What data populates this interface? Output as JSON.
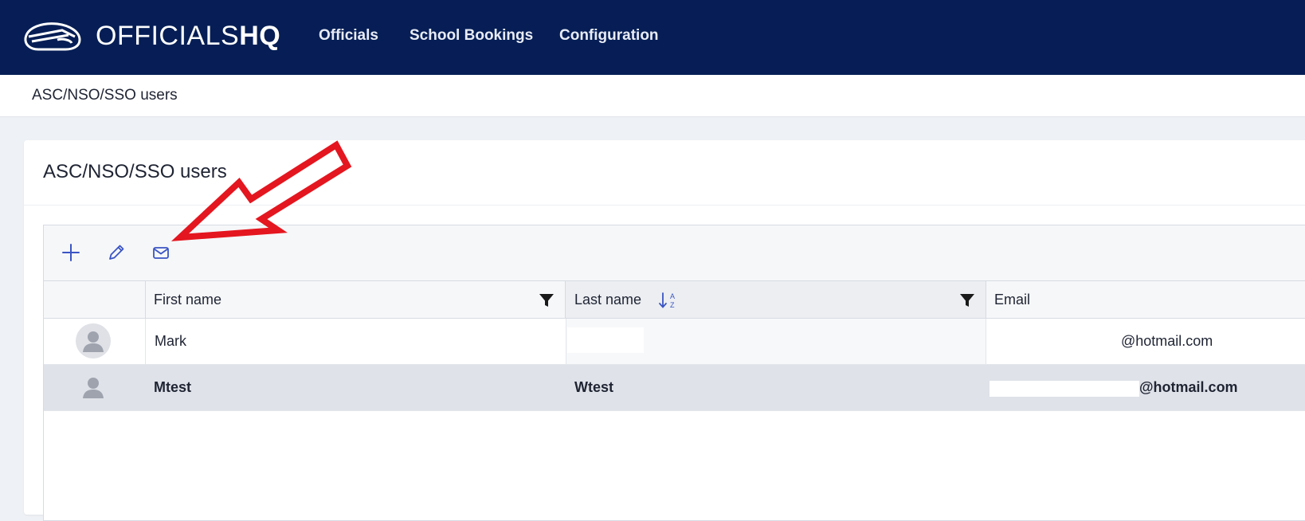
{
  "brand": {
    "light": "OFFICIALS",
    "bold": "HQ",
    "logo_icon": "helmet-logo-icon"
  },
  "nav": [
    {
      "label": "Officials"
    },
    {
      "label": "School Bookings"
    },
    {
      "label": "Configuration"
    }
  ],
  "breadcrumb": "ASC/NSO/SSO users",
  "card": {
    "title": "ASC/NSO/SSO users"
  },
  "toolbar": {
    "icons": [
      "plus-icon",
      "pencil-icon",
      "envelope-icon"
    ]
  },
  "columns": [
    {
      "label": "",
      "key": "avatar"
    },
    {
      "label": "First name",
      "filter": true
    },
    {
      "label": "Last name",
      "filter": true,
      "sort": "ascending"
    },
    {
      "label": "Email"
    }
  ],
  "rows": [
    {
      "first_name": "Mark",
      "last_name": "",
      "email": "@hotmail.com",
      "selected": false
    },
    {
      "first_name": "Mtest",
      "last_name": "Wtest",
      "email": "@hotmail.com",
      "selected": true
    }
  ],
  "colors": {
    "topbar": "#061e55",
    "accent_icon": "#3b55c4",
    "annotation_arrow": "#e4161f",
    "selected_row": "#dfe2e8"
  }
}
